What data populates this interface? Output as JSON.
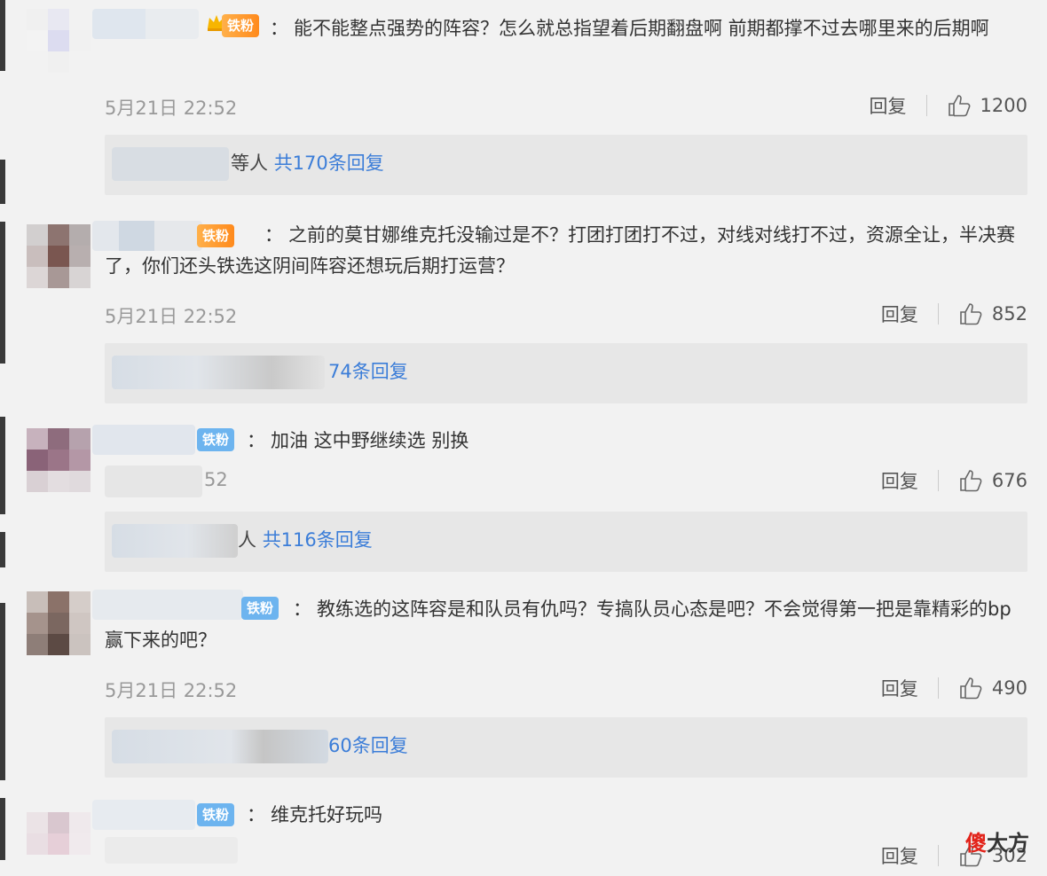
{
  "comments": [
    {
      "badge": "",
      "text": "能不能整点强势的阵容？怎么就总指望着后期翻盘啊 前期都撑不过去哪里来的后期啊",
      "time": "5月21日 22:52",
      "reply_label": "回复",
      "likes": "1200",
      "replies_prefix": "等人",
      "replies_count": "共170条回复"
    },
    {
      "badge": "铁粉",
      "text": "之前的莫甘娜维克托没输过是不？打团打团打不过，对线对线打不过，资源全让，半决赛了，你们还头铁选这阴间阵容还想玩后期打运营？",
      "time": "5月21日 22:52",
      "reply_label": "回复",
      "likes": "852",
      "replies_prefix": "",
      "replies_count": "74条回复"
    },
    {
      "badge": "铁粉",
      "text": "加油 这中野继续选 别换",
      "time": "52",
      "reply_label": "回复",
      "likes": "676",
      "replies_prefix": "人",
      "replies_count": "共116条回复"
    },
    {
      "badge": "铁粉",
      "text": "教练选的这阵容是和队员有仇吗？专搞队员心态是吧？不会觉得第一把是靠精彩的bp赢下来的吧？",
      "time": "5月21日 22:52",
      "reply_label": "回复",
      "likes": "490",
      "replies_prefix": "",
      "replies_count": "60条回复"
    },
    {
      "badge": "铁粉",
      "text": "维克托好玩吗",
      "time": "",
      "reply_label": "回复",
      "likes": "302",
      "replies_prefix": "",
      "replies_count": ""
    }
  ],
  "badge_first": "铁粉",
  "watermark": {
    "red": "傻",
    "dark": "大方"
  },
  "colors": {
    "link": "#3b7dd8",
    "badge_blue": "#6db4ef",
    "badge_orange": "#ff9a2e",
    "bg": "#f2f2f2"
  }
}
